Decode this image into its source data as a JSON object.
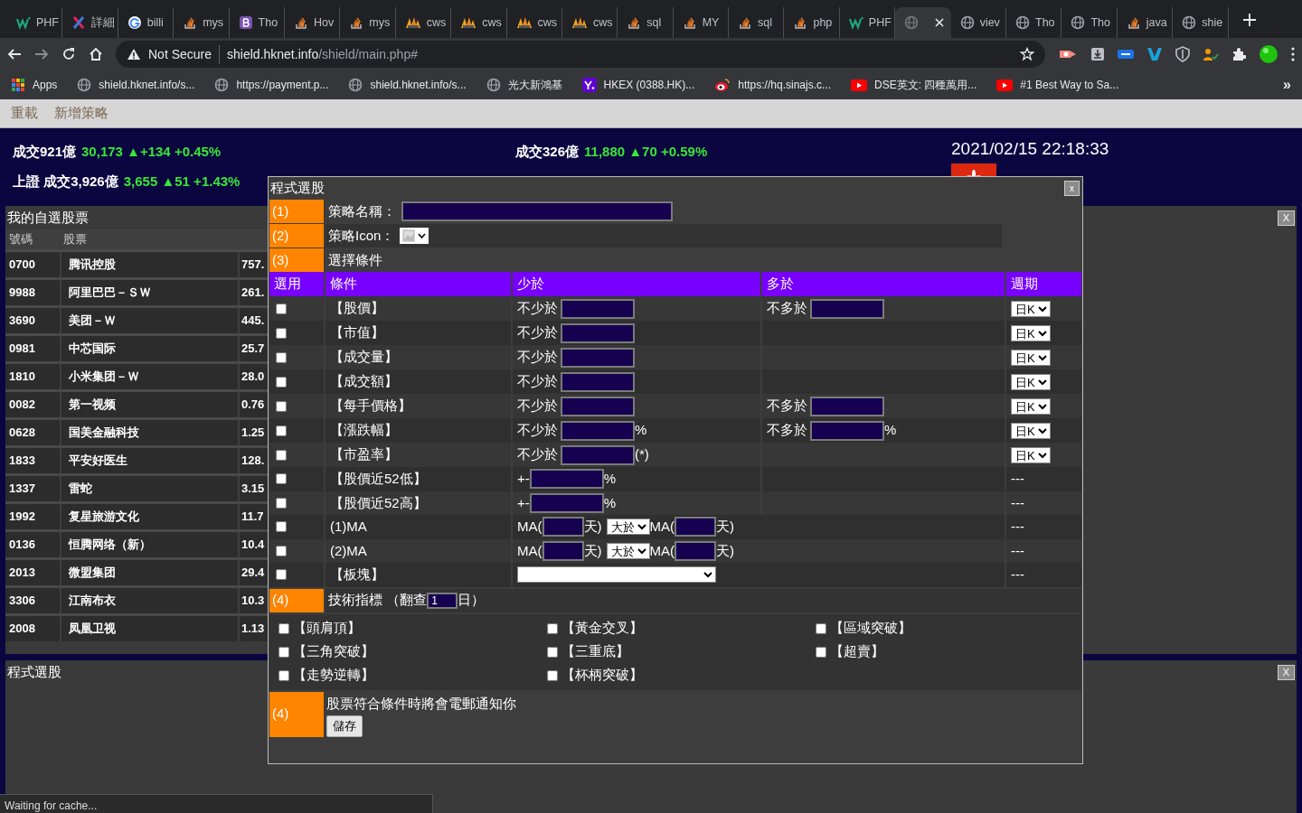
{
  "browser": {
    "tabs": [
      {
        "kind": "w3",
        "title": "PHF",
        "selected": false
      },
      {
        "kind": "x",
        "title": "詳細",
        "selected": false
      },
      {
        "kind": "google",
        "title": "billi",
        "selected": false
      },
      {
        "kind": "stack",
        "title": "mys",
        "selected": false
      },
      {
        "kind": "bootstrap",
        "title": "Tho",
        "selected": false
      },
      {
        "kind": "stack",
        "title": "Hov",
        "selected": false
      },
      {
        "kind": "stack",
        "title": "mys",
        "selected": false
      },
      {
        "kind": "cws",
        "title": "cws",
        "selected": false
      },
      {
        "kind": "cws",
        "title": "cws",
        "selected": false
      },
      {
        "kind": "cws",
        "title": "cws",
        "selected": false
      },
      {
        "kind": "cws",
        "title": "cws",
        "selected": false
      },
      {
        "kind": "stack",
        "title": "sql",
        "selected": false
      },
      {
        "kind": "stack",
        "title": "MY",
        "selected": false
      },
      {
        "kind": "stack",
        "title": "sql",
        "selected": false
      },
      {
        "kind": "stack",
        "title": "php",
        "selected": false
      },
      {
        "kind": "w3",
        "title": "PHF",
        "selected": false
      },
      {
        "kind": "globe",
        "selected": true
      },
      {
        "kind": "globe",
        "title": "viev",
        "selected": false
      },
      {
        "kind": "globe",
        "title": "Tho",
        "selected": false
      },
      {
        "kind": "globe",
        "title": "Tho",
        "selected": false
      },
      {
        "kind": "stack",
        "title": "java",
        "selected": false
      },
      {
        "kind": "globe",
        "title": "shie",
        "selected": false
      }
    ],
    "address": {
      "security": "Not Secure",
      "host": "shield.hknet.info",
      "path": "/shield/main.php#"
    },
    "bookmarks": [
      {
        "kind": "apps",
        "label": "Apps"
      },
      {
        "kind": "globe",
        "label": "shield.hknet.info/s..."
      },
      {
        "kind": "globe",
        "label": "https://payment.p..."
      },
      {
        "kind": "globe",
        "label": "shield.hknet.info/s..."
      },
      {
        "kind": "globe",
        "label": "光大新鴻基"
      },
      {
        "kind": "yahoo",
        "label": "HKEX (0388.HK)..."
      },
      {
        "kind": "weibo",
        "label": "https://hq.sinajs.c..."
      },
      {
        "kind": "youtube",
        "label": "DSE英文: 四種萬用..."
      },
      {
        "kind": "youtube",
        "label": "#1 Best Way to Sa..."
      }
    ],
    "bookmarks_more": "»"
  },
  "menu": [
    "重載",
    "新增策略"
  ],
  "ticker": {
    "left": [
      {
        "label": "成交921億",
        "quote": "30,173 ▲+134 +0.45%"
      },
      {
        "label": "上證 成交3,926億",
        "quote": "3,655 ▲51 +1.43%"
      }
    ],
    "middle": {
      "label": "成交326億",
      "quote": "11,880 ▲70 +0.59%"
    },
    "datetime": "2021/02/15 22:18:33"
  },
  "watchlist": {
    "title": "我的自選股票",
    "close": "X",
    "columns": [
      "號碼",
      "股票"
    ],
    "rows": [
      {
        "code": "0700",
        "name": "腾讯控股",
        "price": "757."
      },
      {
        "code": "9988",
        "name": "阿里巴巴－ＳＷ",
        "price": "261."
      },
      {
        "code": "3690",
        "name": "美团－Ｗ",
        "price": "445."
      },
      {
        "code": "0981",
        "name": "中芯国际",
        "price": "25.7"
      },
      {
        "code": "1810",
        "name": "小米集团－Ｗ",
        "price": "28.0"
      },
      {
        "code": "0082",
        "name": "第一视频",
        "price": "0.76"
      },
      {
        "code": "0628",
        "name": "国美金融科技",
        "price": "1.25"
      },
      {
        "code": "1833",
        "name": "平安好医生",
        "price": "128."
      },
      {
        "code": "1337",
        "name": "雷蛇",
        "price": "3.15"
      },
      {
        "code": "1992",
        "name": "复星旅游文化",
        "price": "11.7"
      },
      {
        "code": "0136",
        "name": "恒腾网络（新）",
        "price": "10.4"
      },
      {
        "code": "2013",
        "name": "微盟集团",
        "price": "29.4"
      },
      {
        "code": "3306",
        "name": "江南布衣",
        "price": "10.3"
      },
      {
        "code": "2008",
        "name": "凤凰卫视",
        "price": "1.13"
      }
    ]
  },
  "bottom_panel": {
    "title": "程式選股",
    "close": "X"
  },
  "dialog": {
    "title": "程式選股",
    "close": "x",
    "name_row": {
      "step": "(1)",
      "label": "策略名稱："
    },
    "icon_row": {
      "step": "(2)",
      "label": "策略Icon："
    },
    "conditions_row": {
      "step": "(3)",
      "label": "選擇條件"
    },
    "columns": [
      "選用",
      "條件",
      "少於",
      "多於",
      "週期"
    ],
    "conditions": [
      {
        "kind": "range",
        "checked": false,
        "label": "【股價】",
        "min_label": "不少於",
        "max_label": "不多於",
        "period": {
          "kind": "select",
          "value": "日K"
        }
      },
      {
        "kind": "range",
        "checked": false,
        "label": "【市值】",
        "min_label": "不少於",
        "period": {
          "kind": "select",
          "value": "日K"
        }
      },
      {
        "kind": "range",
        "checked": false,
        "label": "【成交量】",
        "min_label": "不少於",
        "period": {
          "kind": "select",
          "value": "日K"
        }
      },
      {
        "kind": "range",
        "checked": false,
        "label": "【成交額】",
        "min_label": "不少於",
        "period": {
          "kind": "select",
          "value": "日K"
        }
      },
      {
        "kind": "range",
        "checked": false,
        "label": "【每手價格】",
        "min_label": "不少於",
        "max_label": "不多於",
        "period": {
          "kind": "select",
          "value": "日K"
        }
      },
      {
        "kind": "range",
        "checked": false,
        "label": "【漲跌幅】",
        "min_label": "不少於",
        "min_unit": "%",
        "max_label": "不多於",
        "max_unit": "%",
        "period": {
          "kind": "select",
          "value": "日K"
        }
      },
      {
        "kind": "range",
        "checked": false,
        "label": "【市盈率】",
        "min_label": "不少於",
        "min_unit": "(*)",
        "period": {
          "kind": "select",
          "value": "日K"
        }
      },
      {
        "kind": "near",
        "checked": false,
        "label": "【股價近52低】",
        "prefix": "+-",
        "unit": "%",
        "period": {
          "kind": "text",
          "value": "---"
        }
      },
      {
        "kind": "near",
        "checked": false,
        "label": "【股價近52高】",
        "prefix": "+-",
        "unit": "%",
        "period": {
          "kind": "text",
          "value": "---"
        }
      },
      {
        "kind": "ma",
        "checked": false,
        "label": "(1)MA",
        "open": "MA(",
        "close": "天)",
        "compare": "大於",
        "open2": "MA(",
        "close2": "天)",
        "period": {
          "kind": "text",
          "value": "---"
        }
      },
      {
        "kind": "ma",
        "checked": false,
        "label": "(2)MA",
        "open": "MA(",
        "close": "天)",
        "compare": "大於",
        "open2": "MA(",
        "close2": "天)",
        "period": {
          "kind": "text",
          "value": "---"
        }
      },
      {
        "kind": "sector",
        "checked": false,
        "label": "【板塊】",
        "period": {
          "kind": "text",
          "value": "---"
        }
      }
    ],
    "indicators_row": {
      "step": "(4)",
      "label": "技術指標 （翻查",
      "days": "1",
      "unit": "日）"
    },
    "indicators": [
      {
        "label": "【頭肩頂】",
        "checked": false
      },
      {
        "label": "【黃金交叉】",
        "checked": false
      },
      {
        "label": "【區域突破】",
        "checked": false
      },
      {
        "label": "【三角突破】",
        "checked": false
      },
      {
        "label": "【三重底】",
        "checked": false
      },
      {
        "label": "【超賣】",
        "checked": false
      },
      {
        "label": "【走勢逆轉】",
        "checked": false
      },
      {
        "label": "【杯柄突破】",
        "checked": false
      }
    ],
    "notify_row": {
      "step": "(4)",
      "text": "股票符合條件時將會電郵通知你",
      "button": "儲存"
    }
  },
  "status_bar": "Waiting for cache..."
}
